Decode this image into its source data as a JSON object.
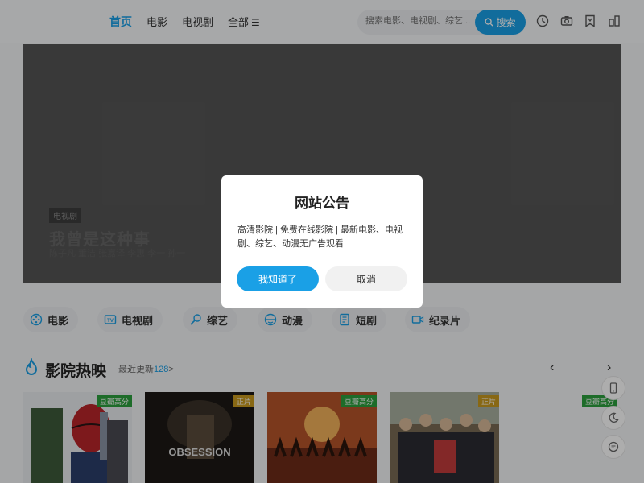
{
  "nav": {
    "items": [
      "首页",
      "电影",
      "电视剧",
      "全部"
    ],
    "active_index": 0,
    "menu_icon": "menu-icon"
  },
  "search": {
    "placeholder": "搜索电影、电视剧、综艺...",
    "button_label": "搜索"
  },
  "header_icons": [
    "history-icon",
    "camera-icon",
    "bookmark-icon",
    "app-icon"
  ],
  "banner": {
    "tag": "电视剧",
    "title": "我曾是这种事",
    "subtitle": "陈子凡 董洁 张嘉译 李惠 李一 孙一"
  },
  "categories": [
    {
      "label": "电影",
      "icon": "film-reel-icon"
    },
    {
      "label": "电视剧",
      "icon": "tv-icon"
    },
    {
      "label": "综艺",
      "icon": "mic-icon"
    },
    {
      "label": "动漫",
      "icon": "anime-icon"
    },
    {
      "label": "短剧",
      "icon": "document-icon"
    },
    {
      "label": "纪录片",
      "icon": "video-camera-icon"
    }
  ],
  "section": {
    "title": "影院热映",
    "more_prefix": "最近更新",
    "more_count": "128",
    "more_suffix": ">"
  },
  "posters": [
    {
      "tag": "豆瓣高分",
      "tag_color": "#2c9f3d"
    },
    {
      "tag": "正片",
      "tag_color": "#c99a1e"
    },
    {
      "tag": "豆瓣高分",
      "tag_color": "#2c9f3d"
    },
    {
      "tag": "正片",
      "tag_color": "#c99a1e"
    },
    {
      "tag": "豆瓣高分",
      "tag_color": "#2c9f3d"
    }
  ],
  "float_tools": [
    "phone-icon",
    "moon-icon",
    "chat-icon"
  ],
  "modal": {
    "title": "网站公告",
    "body": "高清影院 | 免费在线影院 | 最新电影、电视剧、综艺、动漫无广告观看",
    "ok_label": "我知道了",
    "cancel_label": "取消"
  },
  "colors": {
    "accent": "#1aa0e6",
    "green_tag": "#2c9f3d",
    "gold_tag": "#c99a1e"
  }
}
